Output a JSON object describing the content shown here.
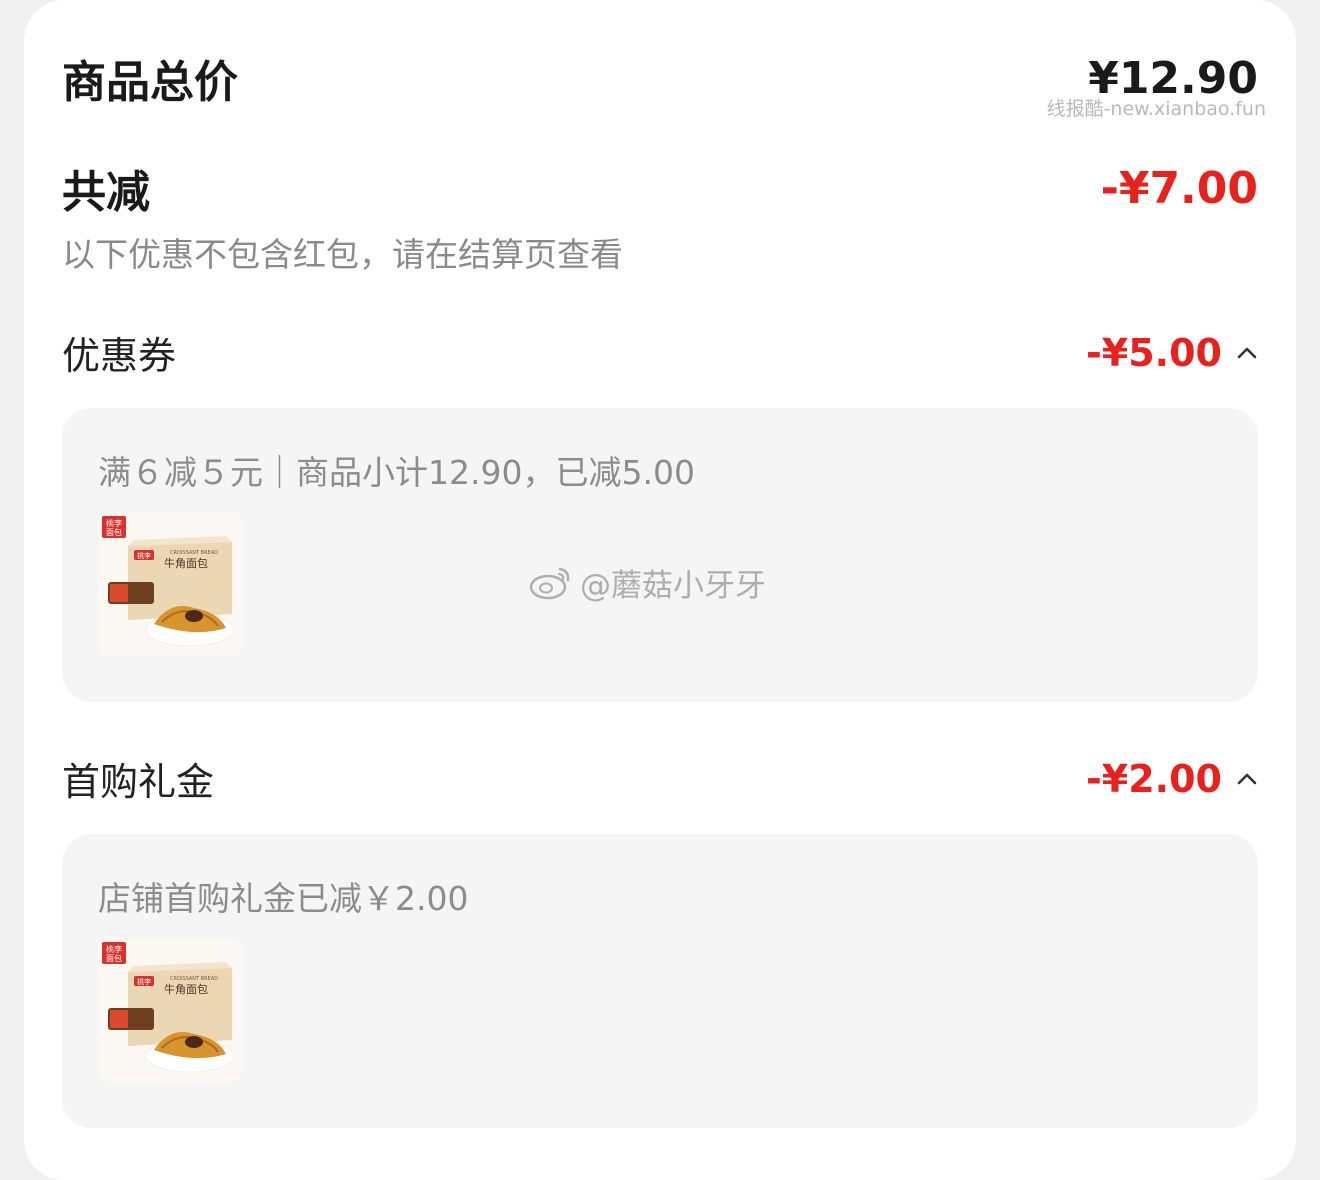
{
  "summary": {
    "total_label": "商品总价",
    "total_value": "¥12.90",
    "discount_label": "共减",
    "discount_value": "-¥7.00",
    "hint": "以下优惠不包含红包，请在结算页查看"
  },
  "coupon": {
    "label": "优惠券",
    "value": "-¥5.00",
    "detail": "满６减５元｜商品小计12.90，已减5.00"
  },
  "first_purchase": {
    "label": "首购礼金",
    "value": "-¥2.00",
    "detail": "店铺首购礼金已减￥2.00"
  },
  "product": {
    "badge": "桃李 面包",
    "brand": "桃李",
    "box_title": "牛角面包",
    "box_subtitle": "CROISSANT BREAD"
  },
  "watermarks": {
    "top": "线报酷-new.xianbao.fun",
    "center": "@蘑菇小牙牙"
  },
  "colors": {
    "accent_red": "#e8211d",
    "panel_bg": "#f5f5f5"
  }
}
